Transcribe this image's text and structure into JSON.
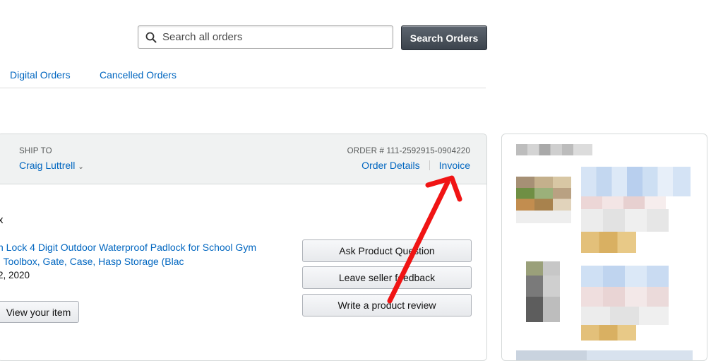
{
  "search": {
    "placeholder": "Search all orders",
    "button_label": "Search Orders"
  },
  "tabs": [
    {
      "label": "Digital Orders"
    },
    {
      "label": "Cancelled Orders"
    }
  ],
  "order": {
    "ship_to_label": "SHIP TO",
    "ship_to_name": "Craig Luttrell",
    "order_number_label": "ORDER # 111-2592915-0904220",
    "order_details_link": "Order Details",
    "invoice_link": "Invoice",
    "status_fragment": "x",
    "product_title_line1": "n Lock 4 Digit Outdoor Waterproof Padlock for School Gym",
    "product_title_line2": ", Toolbox, Gate, Case, Hasp Storage (Blac",
    "date_fragment": "2, 2020",
    "view_item_button": "View your item",
    "actions": [
      {
        "label": "Ask Product Question"
      },
      {
        "label": "Leave seller feedback"
      },
      {
        "label": "Write a product review"
      }
    ]
  },
  "annotation": {
    "arrow_color": "#f01414"
  },
  "colors": {
    "link": "#0066c0",
    "search_button": "#4a525b",
    "header_bg": "#f0f2f2"
  }
}
